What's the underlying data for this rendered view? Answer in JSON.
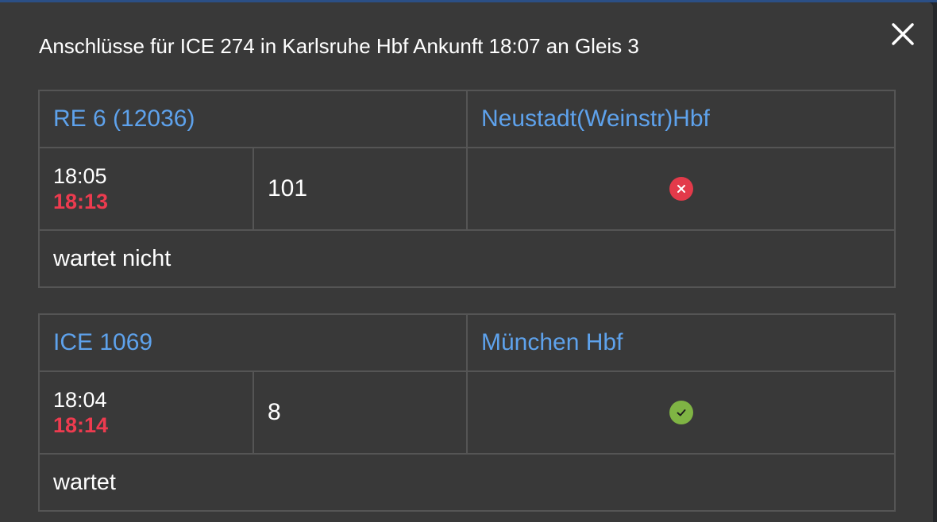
{
  "modal": {
    "title": "Anschlüsse für ICE 274 in Karlsruhe Hbf Ankunft 18:07 an Gleis 3"
  },
  "colors": {
    "link": "#5ea2ec",
    "delay": "#ed3b4f",
    "not_waiting": "#e33a4a",
    "waiting": "#7fb444",
    "modal_bg": "#393939"
  },
  "connections": [
    {
      "train": "RE 6 (12036)",
      "destination": "Neustadt(Weinstr)Hbf",
      "scheduled": "18:05",
      "actual": "18:13",
      "platform": "101",
      "icon": "x-circle-icon",
      "status": "wartet nicht"
    },
    {
      "train": "ICE 1069",
      "destination": "München Hbf",
      "scheduled": "18:04",
      "actual": "18:14",
      "platform": "8",
      "icon": "check-circle-icon",
      "status": "wartet"
    }
  ]
}
